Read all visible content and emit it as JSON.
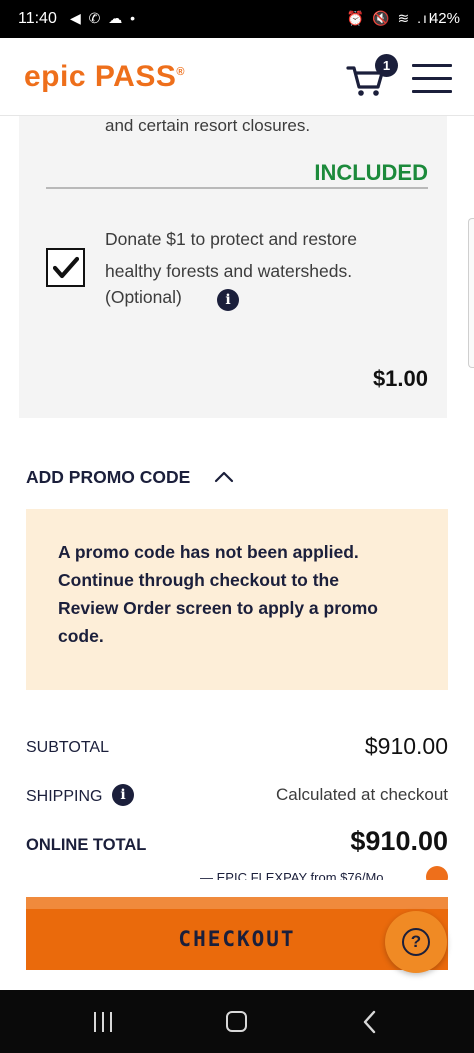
{
  "status_bar": {
    "time": "11:40",
    "left_icons": "◀ ✆ ☁ •",
    "right_icons": "⏰ 🔇 ≋ .ıl",
    "battery": "42%"
  },
  "header": {
    "logo_text": "epic PASS",
    "logo_mark": "®",
    "cart_count": "1"
  },
  "card": {
    "closure_text": "and certain resort closures.",
    "included_label": "INCLUDED",
    "donate_text": "Donate $1 to protect and restore healthy forests and watersheds.",
    "optional_text": "(Optional)",
    "donate_price": "$1.00",
    "donate_checked": true
  },
  "promo": {
    "toggle_label": "ADD PROMO CODE",
    "notice": "A promo code has not been applied. Continue through checkout to the Review Order screen to apply a promo code."
  },
  "summary": {
    "subtotal_label": "SUBTOTAL",
    "subtotal_value": "$910.00",
    "shipping_label": "SHIPPING",
    "shipping_value": "Calculated at checkout",
    "total_label": "ONLINE TOTAL",
    "total_value": "$910.00",
    "flexpay_text": "— EPIC FLEXPAY from $76/Mo"
  },
  "checkout_label": "CHECKOUT",
  "help_label": "?",
  "colors": {
    "brand_orange": "#ee6f1b",
    "navy": "#1b1f3b",
    "included_green": "#1c8a3b",
    "promo_bg": "#fdeed8"
  }
}
